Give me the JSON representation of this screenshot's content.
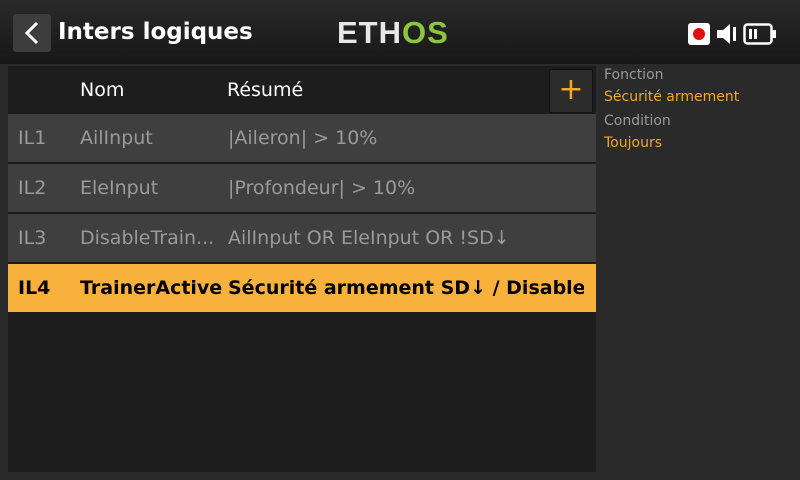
{
  "header": {
    "back_icon": "chevron-left-icon",
    "title": "Inters logiques",
    "logo_part1": "ETH",
    "logo_part2": "OS",
    "logo_colors": {
      "primary": "#e8e8e8",
      "accent": "#8cc63f"
    },
    "status_icons": [
      "record-icon",
      "speaker-icon",
      "battery-icon"
    ]
  },
  "table": {
    "headers": {
      "name": "Nom",
      "summary": "Résumé"
    },
    "add_label": "+",
    "rows": [
      {
        "id": "IL1",
        "name": "AilInput",
        "summary": "|Aileron| > 10%",
        "selected": false
      },
      {
        "id": "IL2",
        "name": "EleInput",
        "summary": "|Profondeur| > 10%",
        "selected": false
      },
      {
        "id": "IL3",
        "name": "DisableTrain...",
        "summary": "AilInput OR EleInput OR !SD↓",
        "selected": false
      },
      {
        "id": "IL4",
        "name": "TrainerActive",
        "summary": "Sécurité armement SD↓ / Disable...",
        "selected": true
      }
    ]
  },
  "details": {
    "function_label": "Fonction",
    "function_value": "Sécurité armement",
    "condition_label": "Condition",
    "condition_value": "Toujours"
  },
  "colors": {
    "accent": "#f5a623",
    "selected_row": "#f7b13c",
    "row_bg": "#3f3f3f"
  }
}
